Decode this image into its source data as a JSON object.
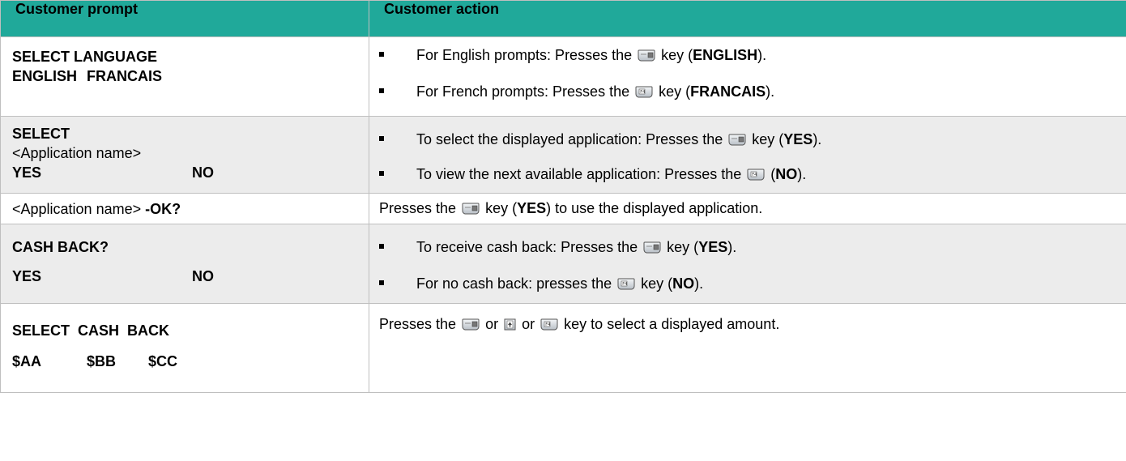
{
  "header": {
    "col1": "Customer prompt",
    "col2": "Customer action"
  },
  "rows": [
    {
      "prompt_line1": "SELECT LANGUAGE",
      "prompt_line2a": "ENGLISH",
      "prompt_line2b": "FRANCAIS",
      "actions": [
        {
          "pre": "For English prompts: Presses the",
          "key": "F1-key-icon",
          "mid": "key (",
          "bold": "ENGLISH",
          "post": ")."
        },
        {
          "pre": "For French prompts: Presses the",
          "key": "F4-key-icon",
          "mid": "key (",
          "bold": "FRANCAIS",
          "post": ")."
        }
      ]
    },
    {
      "prompt_line1": "SELECT",
      "prompt_line2": "<Application name>",
      "prompt_line3a": "YES",
      "prompt_line3b": "NO",
      "actions": [
        {
          "pre": "To select the displayed application: Presses the",
          "key": "F1-key-icon",
          "mid": "key (",
          "bold": "YES",
          "post": ")."
        },
        {
          "pre": "To view the next available application: Presses the",
          "key": "F4-key-icon",
          "mid": "(",
          "bold": "NO",
          "post": ")."
        }
      ]
    },
    {
      "prompt_plain": "<Application name>",
      "prompt_bold": "-OK?",
      "action_pre": "Presses the",
      "action_mid": "key (",
      "action_bold": "YES",
      "action_post": ") to use the displayed application."
    },
    {
      "prompt_line1": "CASH BACK?",
      "prompt_line2a": "YES",
      "prompt_line2b": "NO",
      "actions": [
        {
          "pre": "To receive cash back: Presses the",
          "key": "F1-key-icon",
          "mid": "key (",
          "bold": "YES",
          "post": ")."
        },
        {
          "pre": "For no cash back: presses the",
          "key": "F4-key-icon",
          "mid": "key (",
          "bold": "NO",
          "post": ")."
        }
      ]
    },
    {
      "prompt_line1": "SELECT  CASH  BACK",
      "prompt_line2a": "$AA",
      "prompt_line2b": "$BB",
      "prompt_line2c": "$CC",
      "action_pre": "Presses the",
      "action_or1": "or",
      "action_or2": "or",
      "action_post": "key to select a displayed amount."
    }
  ],
  "colors": {
    "header_bg": "#20a99a",
    "shade_bg": "#ececec",
    "border": "#bfbfbf"
  }
}
